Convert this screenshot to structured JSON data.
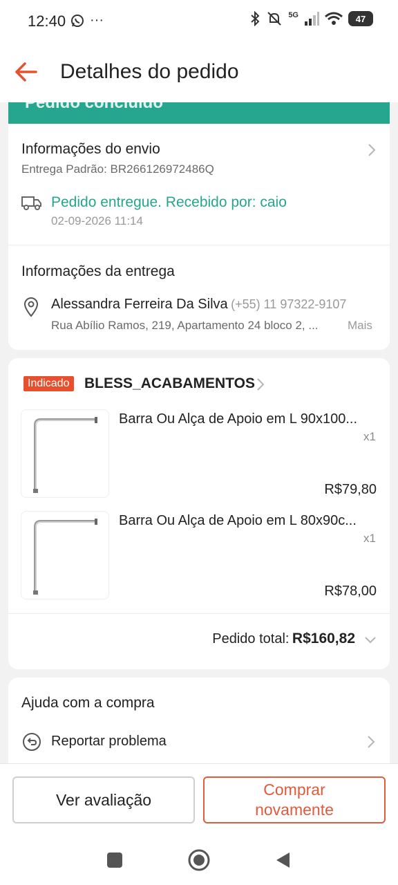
{
  "status_bar": {
    "time": "12:40",
    "more": "···",
    "network": "5G",
    "battery": "47",
    "icons": [
      "whatsapp-icon",
      "bluetooth-icon",
      "mute-icon",
      "signal-icon",
      "wifi-icon",
      "battery-icon"
    ]
  },
  "header": {
    "title": "Detalhes do pedido"
  },
  "banner": {
    "text": "Pedido concluído"
  },
  "shipping": {
    "title": "Informações do envio",
    "carrier": "Entrega Padrão: BR266126972486Q",
    "status": "Pedido entregue. Recebido por: caio",
    "date": "02-09-2026 11:14"
  },
  "delivery": {
    "title": "Informações da entrega",
    "name": "Alessandra Ferreira Da Silva",
    "phone": "(+55) 11 97322-9107",
    "address": "Rua Abílio Ramos, 219, Apartamento 24 bloco 2, ...",
    "more": "Mais"
  },
  "order": {
    "badge": "Indicado",
    "shop": "BLESS_ACABAMENTOS",
    "items": [
      {
        "title": "Barra Ou Alça de Apoio em L 90x100...",
        "qty": "x1",
        "price": "R$79,80"
      },
      {
        "title": "Barra Ou Alça de Apoio em L 80x90c...",
        "qty": "x1",
        "price": "R$78,00"
      }
    ],
    "total_label": "Pedido total:",
    "total_value": "R$160,82"
  },
  "help": {
    "title": "Ajuda com a compra",
    "report": "Reportar problema"
  },
  "actions": {
    "review": "Ver avaliação",
    "buy_again_line1": "Comprar",
    "buy_again_line2": "novamente"
  },
  "colors": {
    "accent": "#e8502d",
    "green": "#26a58f"
  }
}
